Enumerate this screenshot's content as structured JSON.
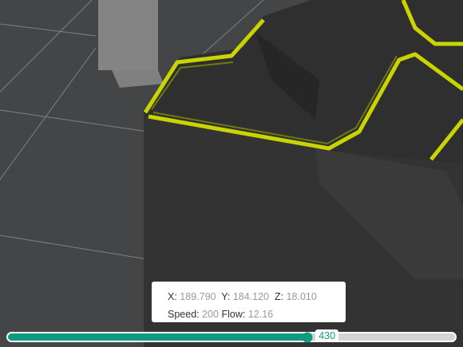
{
  "viewport": {
    "scene": "gcode-preview",
    "colors": {
      "background": "#444547",
      "grid": "#8a8a8a",
      "model": "#2e2e2e",
      "outer_wall": "#d8e000",
      "accent": "#109a82"
    }
  },
  "tooltip": {
    "x_label": "X:",
    "x_value": "189.790",
    "y_label": "Y:",
    "y_value": "184.120",
    "z_label": "Z:",
    "z_value": "18.010",
    "speed_label": "Speed:",
    "speed_value": "200",
    "flow_label": "Flow:",
    "flow_value": "12.16"
  },
  "slider": {
    "value": "430",
    "fraction": 0.67
  }
}
